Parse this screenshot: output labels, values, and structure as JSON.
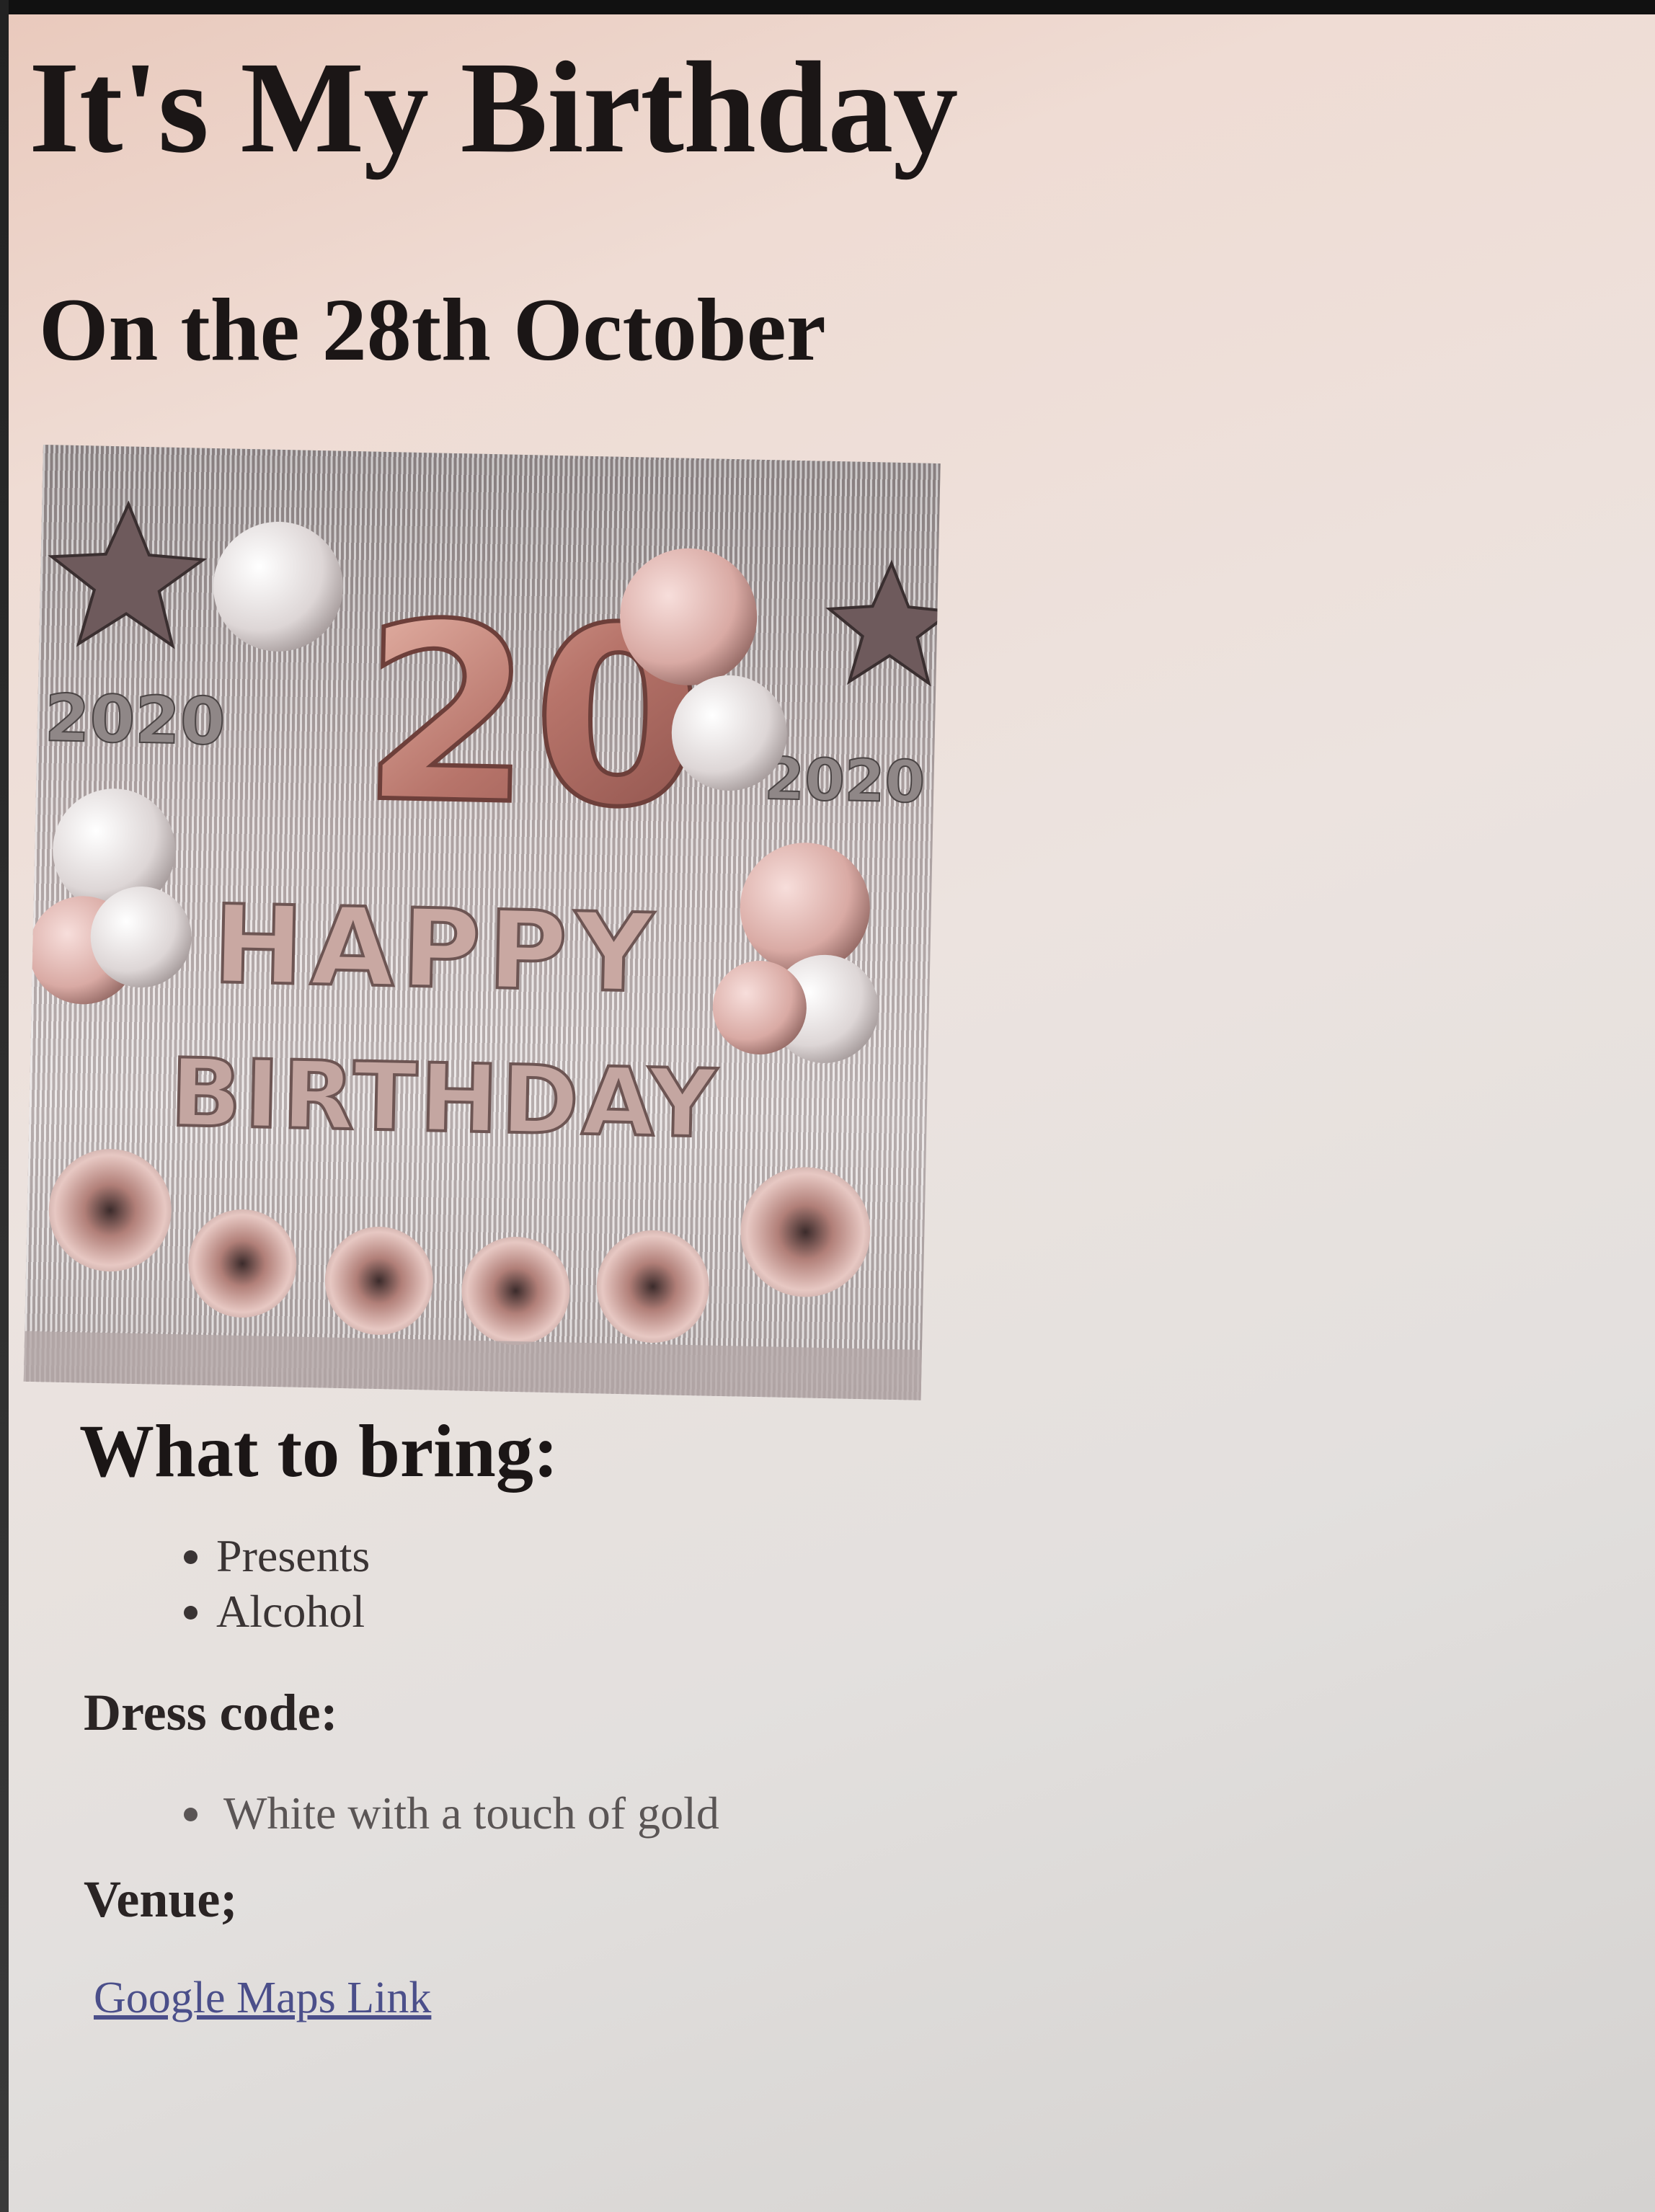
{
  "heading": "It's My Birthday",
  "date_heading": "On the 28th October",
  "photo": {
    "big_number": "20",
    "small_number": "2020",
    "banner_top": "HAPPY",
    "banner_bottom": "BIRTHDAY"
  },
  "bring": {
    "title": "What to bring:",
    "items": [
      "Presents",
      "Alcohol"
    ]
  },
  "dress": {
    "title": "Dress code:",
    "items": [
      "White with a touch of gold"
    ]
  },
  "venue": {
    "title": "Venue;",
    "link_text": "Google Maps Link"
  },
  "colors": {
    "rose_gold": "#c98f85",
    "link": "#4b4f8a"
  }
}
